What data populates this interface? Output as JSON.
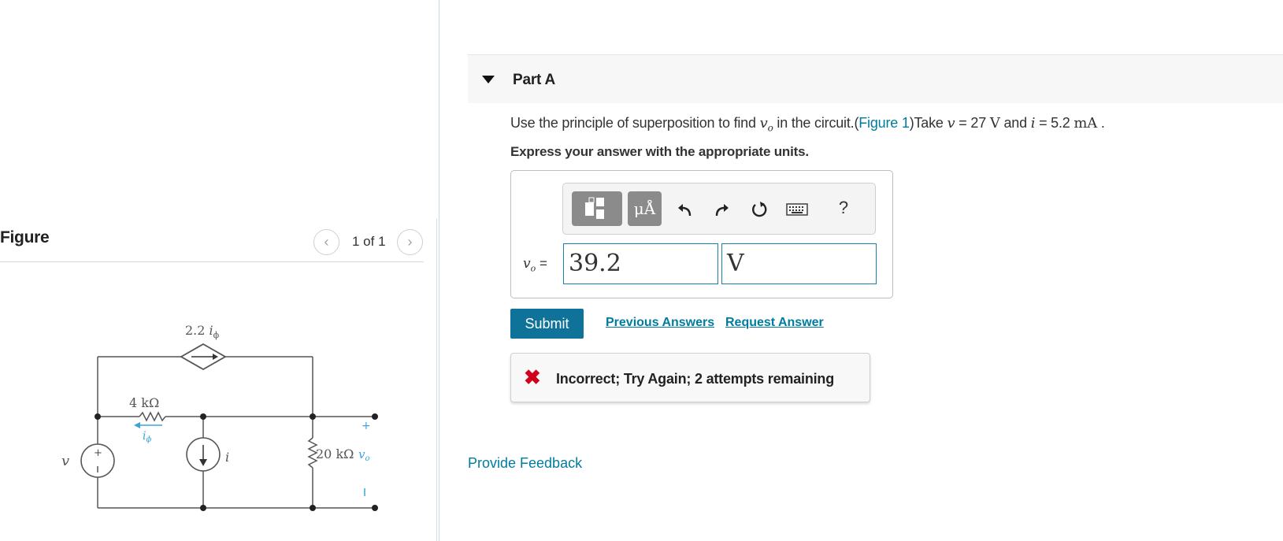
{
  "figure_panel": {
    "title": "Figure",
    "prev_icon": "chevron-left-icon",
    "next_icon": "chevron-right-icon",
    "page_indicator": "1 of 1",
    "circuit": {
      "dependent_source_label": "2.2",
      "dependent_source_subscript": "i",
      "dependent_source_phi": "ϕ",
      "resistor1_label": "4 kΩ",
      "current_label": "i",
      "current_label_sub": "ϕ",
      "voltage_source_label": "v",
      "current_source_label": "i",
      "resistor2_label": "20 kΩ",
      "output_label": "v",
      "output_sub": "o",
      "plus": "+",
      "minus": "−"
    }
  },
  "part": {
    "title": "Part A",
    "question_prefix": "Use the principle of superposition to find ",
    "question_var": "v",
    "question_var_sub": "o",
    "question_mid": " in the circuit.(",
    "figure_link": "Figure 1",
    "question_take": ")Take ",
    "v_symbol": "v",
    "v_eq": " = 27 ",
    "v_unit": "V",
    "and_text": " and ",
    "i_symbol": "i",
    "i_eq": " = 5.2 ",
    "i_unit": "mA",
    "period": " .",
    "instruction": "Express your answer with the appropriate units."
  },
  "toolbar": {
    "templates_icon": "templates-icon",
    "units_label": "μÅ",
    "undo_icon": "undo-icon",
    "redo_icon": "redo-icon",
    "reset_icon": "reset-icon",
    "keyboard_icon": "keyboard-icon",
    "help_label": "?"
  },
  "answer": {
    "label_var": "v",
    "label_sub": "o",
    "label_eq": " =",
    "value": "39.2",
    "unit": "V"
  },
  "actions": {
    "submit": "Submit",
    "previous_answers": "Previous Answers",
    "request_answer": "Request Answer"
  },
  "feedback": {
    "icon": "x-icon",
    "text": "Incorrect; Try Again; 2 attempts remaining"
  },
  "footer": {
    "provide_feedback": "Provide Feedback"
  },
  "colors": {
    "link": "#007c9f",
    "submit_bg": "#0f7399",
    "error": "#d0021b",
    "toolbar_btn": "#8b8b8b"
  }
}
